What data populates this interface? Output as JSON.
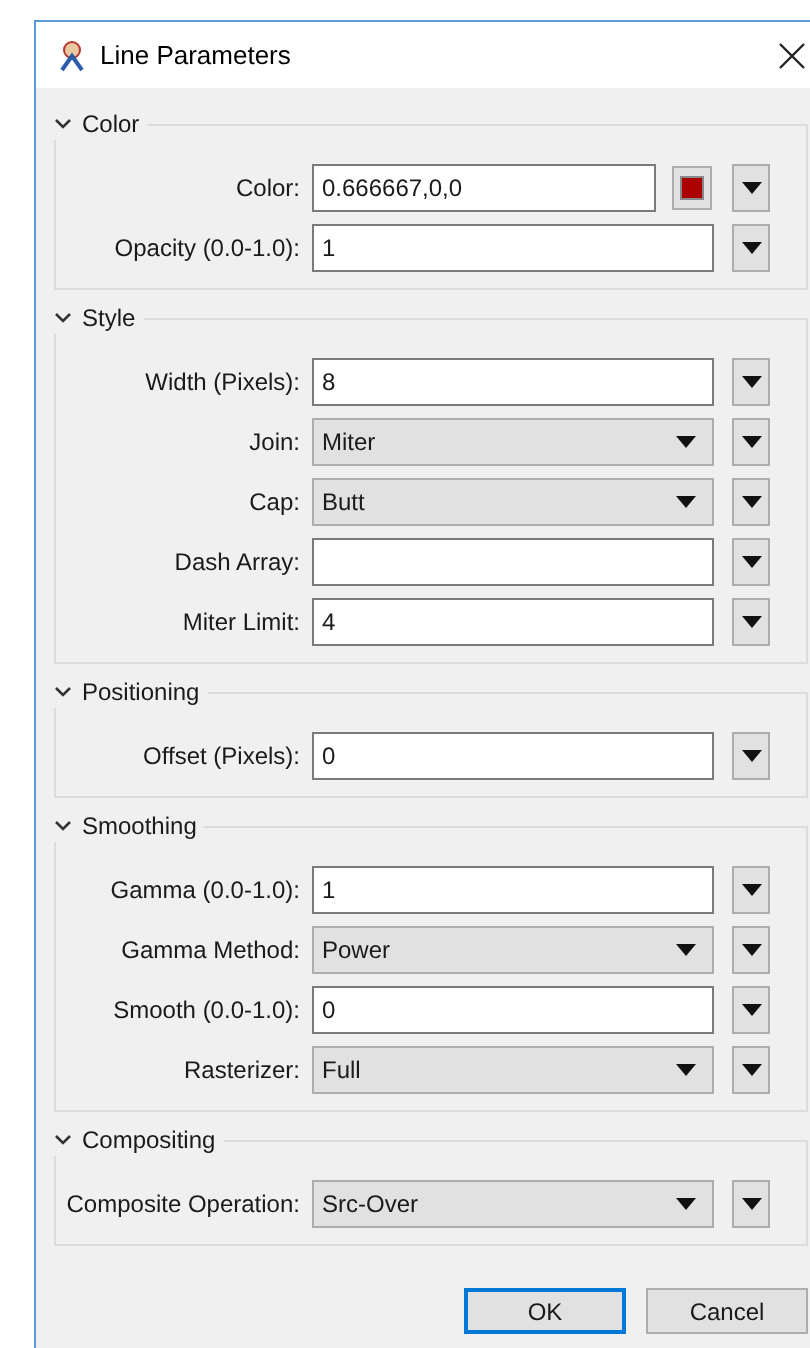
{
  "window": {
    "title": "Line Parameters"
  },
  "sections": [
    {
      "title": "Color",
      "expanded": true,
      "fields": [
        {
          "kind": "color",
          "label": "Color:",
          "value": "0.666667,0,0",
          "color": "#aa0000"
        },
        {
          "kind": "text",
          "label": "Opacity (0.0-1.0):",
          "value": "1"
        }
      ]
    },
    {
      "title": "Style",
      "expanded": true,
      "fields": [
        {
          "kind": "text",
          "label": "Width (Pixels):",
          "value": "8"
        },
        {
          "kind": "select",
          "label": "Join:",
          "value": "Miter"
        },
        {
          "kind": "select",
          "label": "Cap:",
          "value": "Butt"
        },
        {
          "kind": "text",
          "label": "Dash Array:"
        },
        {
          "kind": "text",
          "label": "Miter Limit:",
          "value": "4"
        }
      ]
    },
    {
      "title": "Positioning",
      "expanded": true,
      "fields": [
        {
          "kind": "text",
          "label": "Offset (Pixels):",
          "value": "0"
        }
      ]
    },
    {
      "title": "Smoothing",
      "expanded": true,
      "fields": [
        {
          "kind": "text",
          "label": "Gamma (0.0-1.0):",
          "value": "1"
        },
        {
          "kind": "select",
          "label": "Gamma Method:",
          "value": "Power"
        },
        {
          "kind": "text",
          "label": "Smooth (0.0-1.0):",
          "value": "0"
        },
        {
          "kind": "select",
          "label": "Rasterizer:",
          "value": "Full"
        }
      ]
    },
    {
      "title": "Compositing",
      "expanded": true,
      "fields": [
        {
          "kind": "select",
          "label": "Composite Operation:",
          "value": "Src-Over"
        }
      ]
    }
  ],
  "buttons": [
    {
      "label": "OK",
      "default": true
    },
    {
      "label": "Cancel",
      "default": false
    }
  ]
}
